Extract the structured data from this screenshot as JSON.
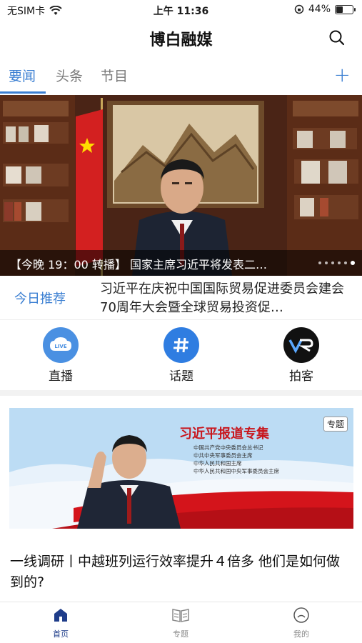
{
  "status_bar": {
    "carrier": "无SIM卡",
    "time": "上午 11:36",
    "battery": "44%",
    "battery_level": 0.44
  },
  "header": {
    "title": "博白融媒",
    "search_icon": "search-icon"
  },
  "tabs": {
    "items": [
      {
        "label": "要闻",
        "active": true
      },
      {
        "label": "头条",
        "active": false
      },
      {
        "label": "节目",
        "active": false
      }
    ],
    "add_label": "+"
  },
  "hero": {
    "caption": "【今晚 19：00 转播】 国家主席习近平将发表二…",
    "dot_count": 6,
    "active_dot": 5
  },
  "recommend": {
    "label": "今日推荐",
    "text": "习近平在庆祝中国国际贸易促进委员会建会70周年大会暨全球贸易投资促…"
  },
  "quick_links": [
    {
      "label": "直播",
      "icon": "live-icon",
      "color": "#4a90e2"
    },
    {
      "label": "话题",
      "icon": "hashtag-icon",
      "color": "#2f7de1"
    },
    {
      "label": "拍客",
      "icon": "vr-icon",
      "color": "#111111"
    }
  ],
  "feature": {
    "tag": "专题",
    "title": "习近平报道专集",
    "subtitle_lines": [
      "中国共产党中央委员会总书记",
      "中共中央军事委员会主席",
      "中华人民共和国主席",
      "中华人民共和国中央军事委员会主席"
    ],
    "live_badge": "LIVE"
  },
  "article": {
    "title": "一线调研丨中越班列运行效率提升４倍多 他们是如何做到的?"
  },
  "bottom_nav": [
    {
      "label": "首页",
      "icon": "home-icon",
      "active": true
    },
    {
      "label": "专题",
      "icon": "book-icon",
      "active": false
    },
    {
      "label": "我的",
      "icon": "profile-icon",
      "active": false
    }
  ],
  "colors": {
    "accent": "#3b7fd2",
    "nav_active": "#1f3d8a",
    "banner_red": "#c8161d"
  }
}
